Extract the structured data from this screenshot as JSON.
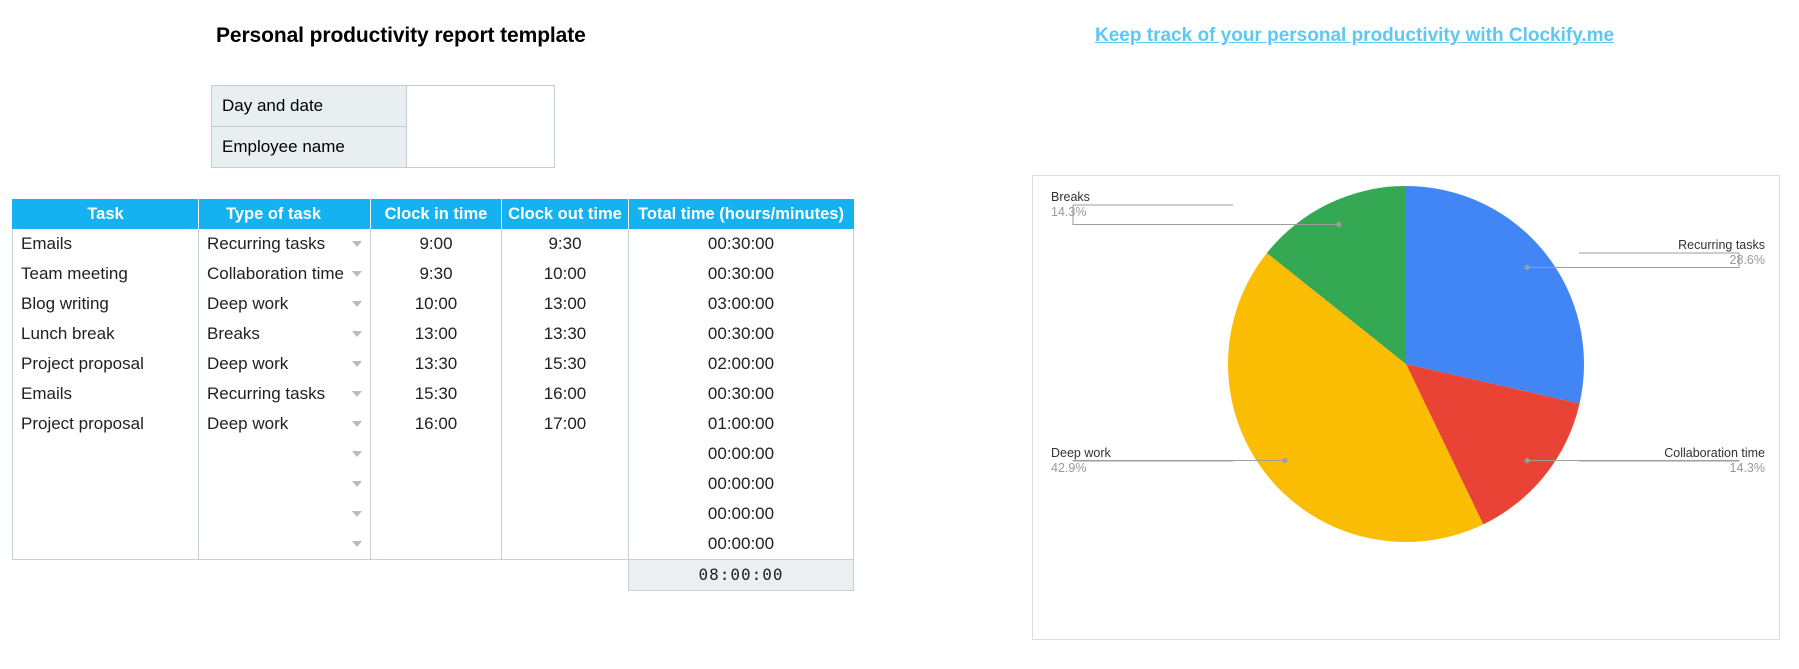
{
  "page": {
    "title": "Personal productivity report template"
  },
  "promo": {
    "link_text": "Keep track of your personal productivity with Clockify.me",
    "link_color": "#5ec8f2"
  },
  "info_box": {
    "rows": [
      {
        "label": "Day and date",
        "value": ""
      },
      {
        "label": "Employee name",
        "value": ""
      }
    ]
  },
  "table": {
    "header_color": "#14b2f0",
    "columns": [
      "Task",
      "Type of task",
      "Clock in time",
      "Clock out time",
      "Total time (hours/minutes)"
    ],
    "rows": [
      {
        "task": "Emails",
        "type": "Recurring tasks",
        "in": "9:00",
        "out": "9:30",
        "total": "00:30:00"
      },
      {
        "task": "Team meeting",
        "type": "Collaboration time",
        "in": "9:30",
        "out": "10:00",
        "total": "00:30:00"
      },
      {
        "task": "Blog writing",
        "type": "Deep work",
        "in": "10:00",
        "out": "13:00",
        "total": "03:00:00"
      },
      {
        "task": "Lunch break",
        "type": "Breaks",
        "in": "13:00",
        "out": "13:30",
        "total": "00:30:00"
      },
      {
        "task": "Project proposal",
        "type": "Deep work",
        "in": "13:30",
        "out": "15:30",
        "total": "02:00:00"
      },
      {
        "task": "Emails",
        "type": "Recurring tasks",
        "in": "15:30",
        "out": "16:00",
        "total": "00:30:00"
      },
      {
        "task": "Project proposal",
        "type": "Deep work",
        "in": "16:00",
        "out": "17:00",
        "total": "01:00:00"
      },
      {
        "task": "",
        "type": "",
        "in": "",
        "out": "",
        "total": "00:00:00"
      },
      {
        "task": "",
        "type": "",
        "in": "",
        "out": "",
        "total": "00:00:00"
      },
      {
        "task": "",
        "type": "",
        "in": "",
        "out": "",
        "total": "00:00:00"
      },
      {
        "task": "",
        "type": "",
        "in": "",
        "out": "",
        "total": "00:00:00"
      }
    ],
    "grand_total": "08:00:00"
  },
  "chart_data": {
    "type": "pie",
    "title": "",
    "categories": [
      "Recurring tasks",
      "Collaboration time",
      "Deep work",
      "Breaks"
    ],
    "values": [
      28.6,
      14.3,
      42.9,
      14.3
    ],
    "value_labels": [
      "28.6%",
      "14.3%",
      "42.9%",
      "14.3%"
    ],
    "colors": [
      "#4285f4",
      "#e94335",
      "#fbbc04",
      "#34a853"
    ],
    "start_angle": 0,
    "direction": "clockwise",
    "legend": "labeled-callouts",
    "labels": [
      {
        "name": "Breaks",
        "pct": "14.3%",
        "side": "left"
      },
      {
        "name": "Recurring tasks",
        "pct": "28.6%",
        "side": "right"
      },
      {
        "name": "Deep work",
        "pct": "42.9%",
        "side": "left"
      },
      {
        "name": "Collaboration time",
        "pct": "14.3%",
        "side": "right"
      }
    ]
  }
}
